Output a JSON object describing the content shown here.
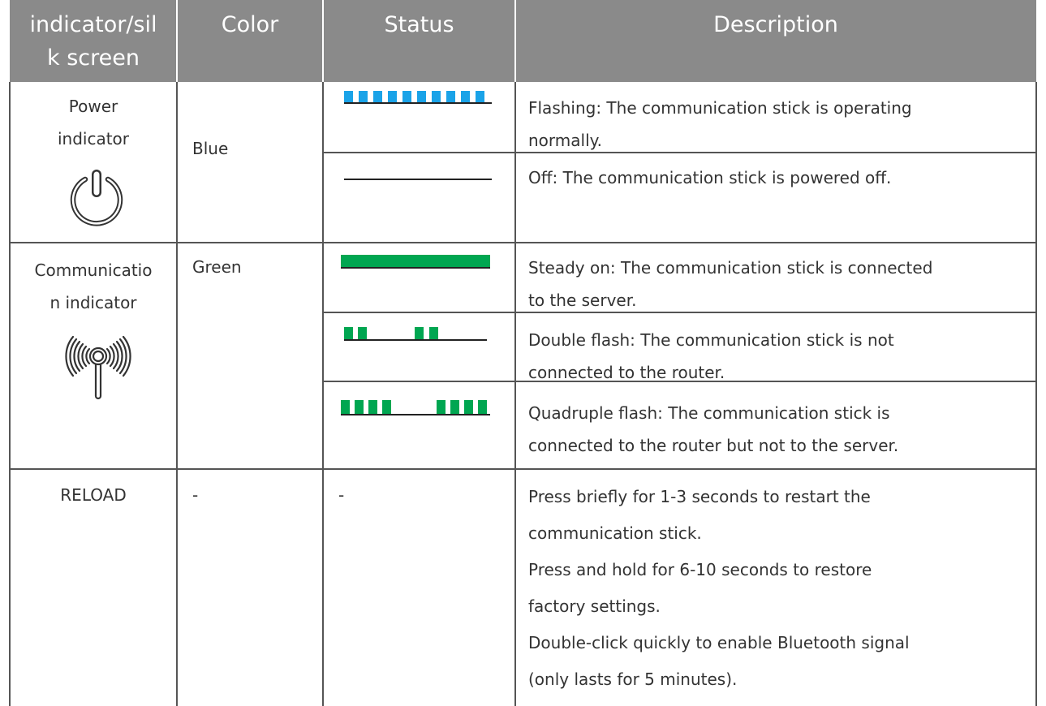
{
  "header": {
    "col1": [
      "indicator/sil",
      "k screen"
    ],
    "col2": "Color",
    "col3": "Status",
    "col4": "Description"
  },
  "rows": {
    "power": {
      "indicator": [
        "Power",
        "indicator"
      ],
      "icon": "power-icon",
      "color": "Blue",
      "states": [
        {
          "pattern": "blue-flashing",
          "description": [
            "Flashing: The communication stick is operating",
            "normally."
          ]
        },
        {
          "pattern": "off-line",
          "description": [
            "Off: The communication stick is powered off."
          ]
        }
      ]
    },
    "communication": {
      "indicator": [
        "Communicatio",
        "n indicator"
      ],
      "icon": "wireless-signal-icon",
      "color": "Green",
      "states": [
        {
          "pattern": "green-steady",
          "description": [
            "Steady on: The communication stick is connected",
            "to the server."
          ]
        },
        {
          "pattern": "green-double-flash",
          "description": [
            "Double flash: The communication stick is not",
            "connected to the router."
          ]
        },
        {
          "pattern": "green-quadruple-flash",
          "description": [
            "Quadruple flash: The communication stick is",
            "connected to the router but not to the server."
          ]
        }
      ]
    },
    "reload": {
      "indicator": "RELOAD",
      "color": "-",
      "status": "-",
      "description": [
        "Press briefly for 1-3 seconds to restart the",
        "communication stick.",
        "Press and hold for 6-10 seconds to restore",
        "factory settings.",
        "Double-click quickly to enable Bluetooth signal",
        "(only lasts for 5 minutes)."
      ]
    }
  },
  "colors": {
    "header_bg": "#8a8a8a",
    "blue": "#1aa3e8",
    "green": "#00a651",
    "line": "#333333"
  }
}
